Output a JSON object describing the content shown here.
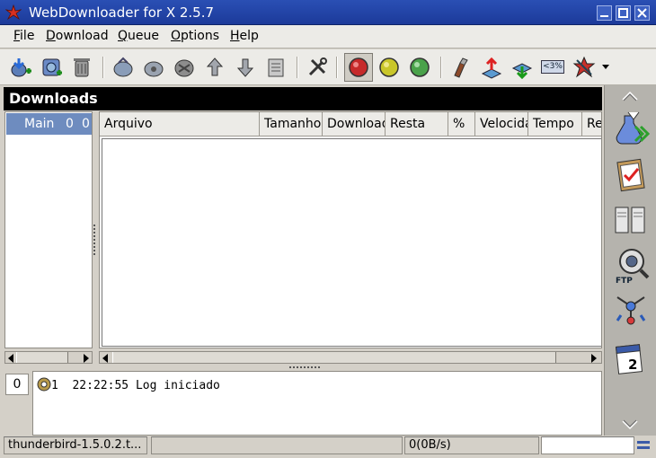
{
  "window": {
    "title": "WebDownloader for X 2.5.7"
  },
  "menu": {
    "items": [
      {
        "label_rest": "ile",
        "accel": "F"
      },
      {
        "label_rest": "ownload",
        "accel": "D"
      },
      {
        "label_rest": "ueue",
        "accel": "Q"
      },
      {
        "label_rest": "ptions",
        "accel": "O"
      },
      {
        "label_rest": "elp",
        "accel": "H"
      }
    ]
  },
  "toolbar": {
    "icons": [
      "add-download-icon",
      "add-clipboard-icon",
      "delete-icon",
      "run-icon",
      "stop-icon",
      "delete-completed-icon",
      "move-up-icon",
      "move-down-icon",
      "log-icon",
      "settings-icon",
      "red-light-icon",
      "yellow-light-icon",
      "green-light-icon",
      "find-icon",
      "speed-up-icon",
      "speed-down-icon",
      "speed-limit-icon",
      "theme-icon",
      "dropdown-arrow-icon"
    ],
    "speed_label": "<3%"
  },
  "downloads": {
    "header": "Downloads",
    "tree": {
      "item_label": "Main",
      "count_a": "0",
      "count_b": "0"
    },
    "columns": [
      "Arquivo",
      "Tamanho",
      "Downloaded",
      "Resta",
      "%",
      "Velocidade",
      "Tempo",
      "Re"
    ]
  },
  "log": {
    "count": "0",
    "line_number": "1",
    "line_time": "22:22:55",
    "line_text": "Log iniciado"
  },
  "side_icons": [
    "scroll-up-icon",
    "new-download-icon",
    "task-list-icon",
    "servers-icon",
    "ftp-search-icon",
    "network-icon",
    "calendar-icon",
    "scroll-down-icon"
  ],
  "status": {
    "file": "thunderbird-1.5.0.2.t...",
    "progress": "",
    "speed": "0(0B/s)",
    "extra": ""
  }
}
